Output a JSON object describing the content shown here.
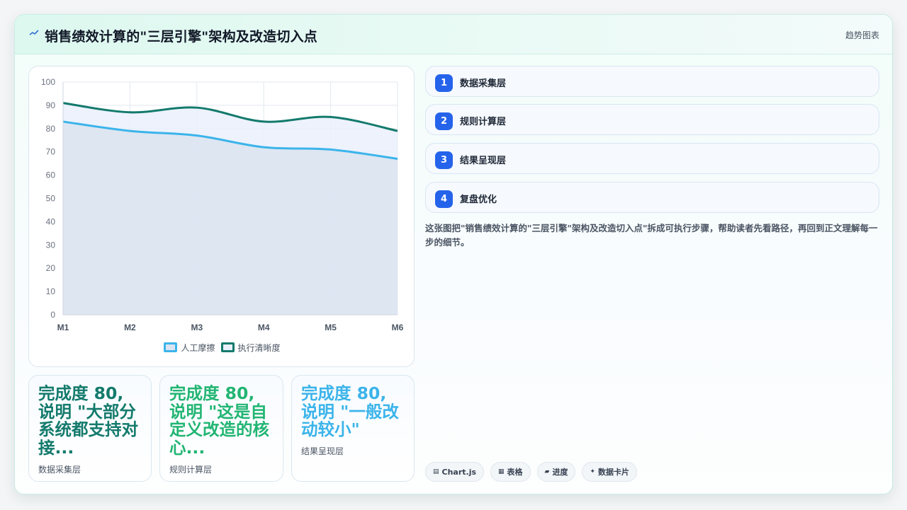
{
  "header": {
    "title": "销售绩效计算的\"三层引擎\"架构及改造切入点",
    "chip": "趋势图表",
    "icon": "sparkline-icon"
  },
  "chart_data": {
    "type": "line",
    "categories": [
      "M1",
      "M2",
      "M3",
      "M4",
      "M5",
      "M6"
    ],
    "series": [
      {
        "name": "人工摩擦",
        "values": [
          83,
          79,
          77,
          72,
          71,
          67
        ],
        "color": "#3bb4ea",
        "fill": "#dbe4f0"
      },
      {
        "name": "执行清晰度",
        "values": [
          91,
          87,
          89,
          83,
          85,
          79
        ],
        "color": "#137a6c",
        "fill": "#eaf0fb"
      }
    ],
    "ylim": [
      0,
      100
    ],
    "yticks": [
      0,
      10,
      20,
      30,
      40,
      50,
      60,
      70,
      80,
      90,
      100
    ],
    "grid": true,
    "legend": "bottom",
    "title": "",
    "xlabel": "",
    "ylabel": ""
  },
  "minis": [
    {
      "big": "完成度 80, 说明 \"大部分系统都支持对接...",
      "sub": "数据采集层",
      "color": "#137a6c"
    },
    {
      "big": "完成度 80, 说明 \"这是自定义改造的核心...",
      "sub": "规则计算层",
      "color": "#22b573"
    },
    {
      "big": "完成度 80, 说明 \"一般改动较小\"",
      "sub": "结果呈现层",
      "color": "#3bb4ea"
    }
  ],
  "steps": [
    {
      "num": "1",
      "label": "数据采集层"
    },
    {
      "num": "2",
      "label": "规则计算层"
    },
    {
      "num": "3",
      "label": "结果呈现层"
    },
    {
      "num": "4",
      "label": "复盘优化"
    }
  ],
  "description": "这张图把\"销售绩效计算的\"三层引擎\"架构及改造切入点\"拆成可执行步骤，帮助读者先看路径，再回到正文理解每一步的细节。",
  "tags": [
    {
      "icon": "chart-icon",
      "glyph": "▤",
      "label": "Chart.js"
    },
    {
      "icon": "table-icon",
      "glyph": "▦",
      "label": "表格"
    },
    {
      "icon": "progress-icon",
      "glyph": "▰",
      "label": "进度"
    },
    {
      "icon": "data-card-icon",
      "glyph": "✦",
      "label": "数据卡片"
    }
  ]
}
